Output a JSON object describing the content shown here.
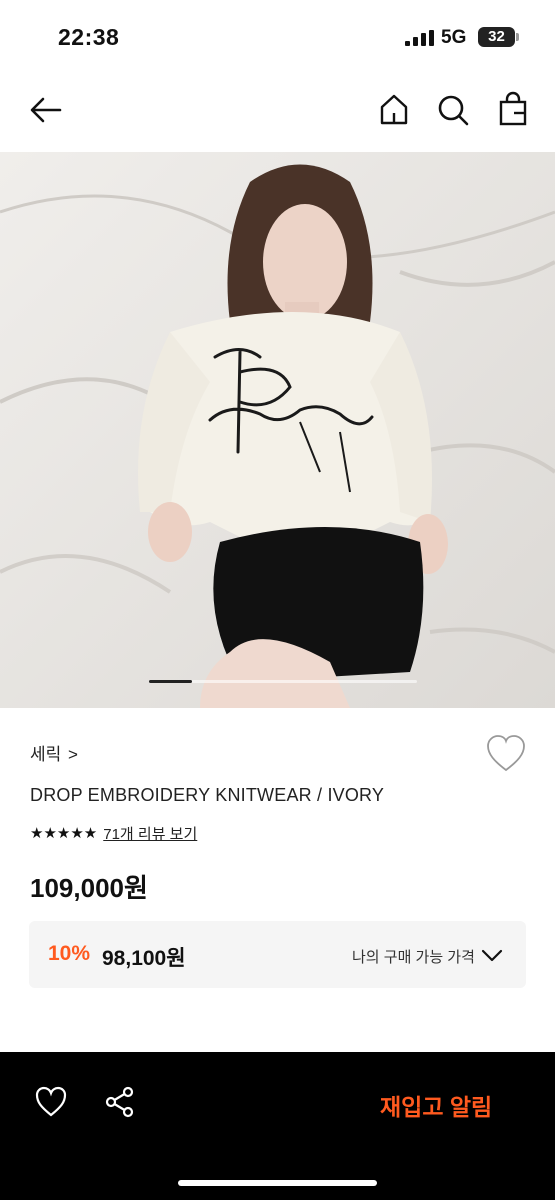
{
  "status_bar": {
    "time": "22:38",
    "network": "5G",
    "battery": "32"
  },
  "nav": {
    "icons": [
      "back-arrow-icon",
      "home-icon",
      "search-icon",
      "shopping-bag-icon"
    ]
  },
  "product": {
    "brand": "세릭",
    "brand_chevron": ">",
    "title": "DROP EMBROIDERY KNITWEAR / IVORY",
    "stars": "★★★★★",
    "rating": 5,
    "review_link": "71개 리뷰 보기",
    "price": "109,000원",
    "image_carousel_progress": 0.16
  },
  "discount": {
    "rate": "10%",
    "price": "98,100원",
    "my_price_label": "나의 구매 가능 가격"
  },
  "bottom_bar": {
    "restock_label": "재입고 알림",
    "icons": [
      "heart-icon",
      "share-icon"
    ]
  },
  "colors": {
    "accent": "#ff5a1f",
    "bar": "#000000",
    "panel": "#f5f5f5"
  }
}
